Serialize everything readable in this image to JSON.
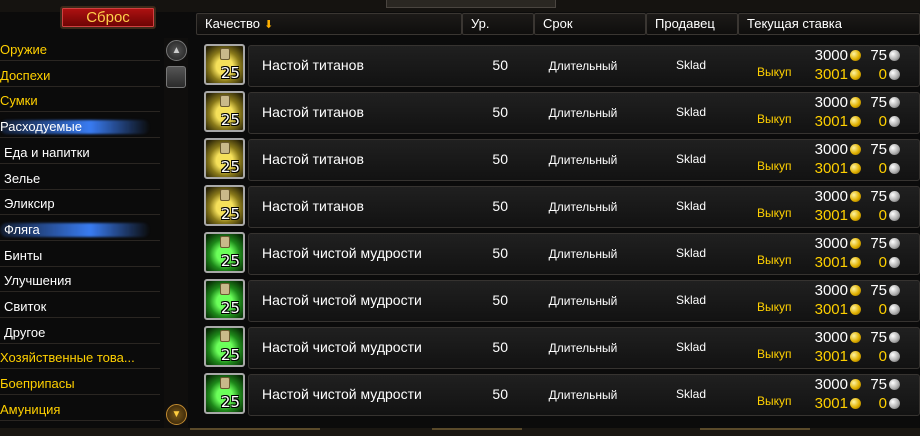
{
  "reset_button": "Сброс",
  "headers": {
    "quality": "Качество",
    "quality_sort_arrow": "arrow-down-icon",
    "level": "Ур.",
    "duration": "Срок",
    "seller": "Продавец",
    "current_bid": "Текущая ставка"
  },
  "categories": [
    {
      "label": "Оружие",
      "level": 0,
      "selected": false
    },
    {
      "label": "Доспехи",
      "level": 0,
      "selected": false
    },
    {
      "label": "Сумки",
      "level": 0,
      "selected": false
    },
    {
      "label": "Расходуемые",
      "level": 0,
      "selected": true
    },
    {
      "label": "Еда и напитки",
      "level": 1,
      "selected": false
    },
    {
      "label": "Зелье",
      "level": 1,
      "selected": false
    },
    {
      "label": "Эликсир",
      "level": 1,
      "selected": false
    },
    {
      "label": "Фляга",
      "level": 1,
      "selected": true
    },
    {
      "label": "Бинты",
      "level": 1,
      "selected": false
    },
    {
      "label": "Улучшения",
      "level": 1,
      "selected": false
    },
    {
      "label": "Свиток",
      "level": 1,
      "selected": false
    },
    {
      "label": "Другое",
      "level": 1,
      "selected": false
    },
    {
      "label": "Хозяйственные това...",
      "level": 0,
      "selected": false
    },
    {
      "label": "Боеприпасы",
      "level": 0,
      "selected": false
    },
    {
      "label": "Амуниция",
      "level": 0,
      "selected": false
    }
  ],
  "buyout_label": "Выкуп",
  "colors": {
    "category_gold": "#ffd000",
    "selection_blue": "#3c82ff",
    "buyout_gold": "#ffd000"
  },
  "listings": [
    {
      "icon": "flask-of-titans-icon",
      "icon_color": "yellow",
      "stack": "25",
      "name": "Настой титанов",
      "level": "50",
      "duration": "Длительный",
      "seller": "Sklad",
      "bid_gold": "3000",
      "bid_silver": "75",
      "buyout_gold": "3001",
      "buyout_silver": "0"
    },
    {
      "icon": "flask-of-titans-icon",
      "icon_color": "yellow",
      "stack": "25",
      "name": "Настой титанов",
      "level": "50",
      "duration": "Длительный",
      "seller": "Sklad",
      "bid_gold": "3000",
      "bid_silver": "75",
      "buyout_gold": "3001",
      "buyout_silver": "0"
    },
    {
      "icon": "flask-of-titans-icon",
      "icon_color": "yellow",
      "stack": "25",
      "name": "Настой титанов",
      "level": "50",
      "duration": "Длительный",
      "seller": "Sklad",
      "bid_gold": "3000",
      "bid_silver": "75",
      "buyout_gold": "3001",
      "buyout_silver": "0"
    },
    {
      "icon": "flask-of-titans-icon",
      "icon_color": "yellow",
      "stack": "25",
      "name": "Настой титанов",
      "level": "50",
      "duration": "Длительный",
      "seller": "Sklad",
      "bid_gold": "3000",
      "bid_silver": "75",
      "buyout_gold": "3001",
      "buyout_silver": "0"
    },
    {
      "icon": "flask-of-pure-wisdom-icon",
      "icon_color": "green",
      "stack": "25",
      "name": "Настой чистой мудрости",
      "level": "50",
      "duration": "Длительный",
      "seller": "Sklad",
      "bid_gold": "3000",
      "bid_silver": "75",
      "buyout_gold": "3001",
      "buyout_silver": "0"
    },
    {
      "icon": "flask-of-pure-wisdom-icon",
      "icon_color": "green",
      "stack": "25",
      "name": "Настой чистой мудрости",
      "level": "50",
      "duration": "Длительный",
      "seller": "Sklad",
      "bid_gold": "3000",
      "bid_silver": "75",
      "buyout_gold": "3001",
      "buyout_silver": "0"
    },
    {
      "icon": "flask-of-pure-wisdom-icon",
      "icon_color": "green",
      "stack": "25",
      "name": "Настой чистой мудрости",
      "level": "50",
      "duration": "Длительный",
      "seller": "Sklad",
      "bid_gold": "3000",
      "bid_silver": "75",
      "buyout_gold": "3001",
      "buyout_silver": "0"
    },
    {
      "icon": "flask-of-pure-wisdom-icon",
      "icon_color": "green",
      "stack": "25",
      "name": "Настой чистой мудрости",
      "level": "50",
      "duration": "Длительный",
      "seller": "Sklad",
      "bid_gold": "3000",
      "bid_silver": "75",
      "buyout_gold": "3001",
      "buyout_silver": "0"
    }
  ]
}
